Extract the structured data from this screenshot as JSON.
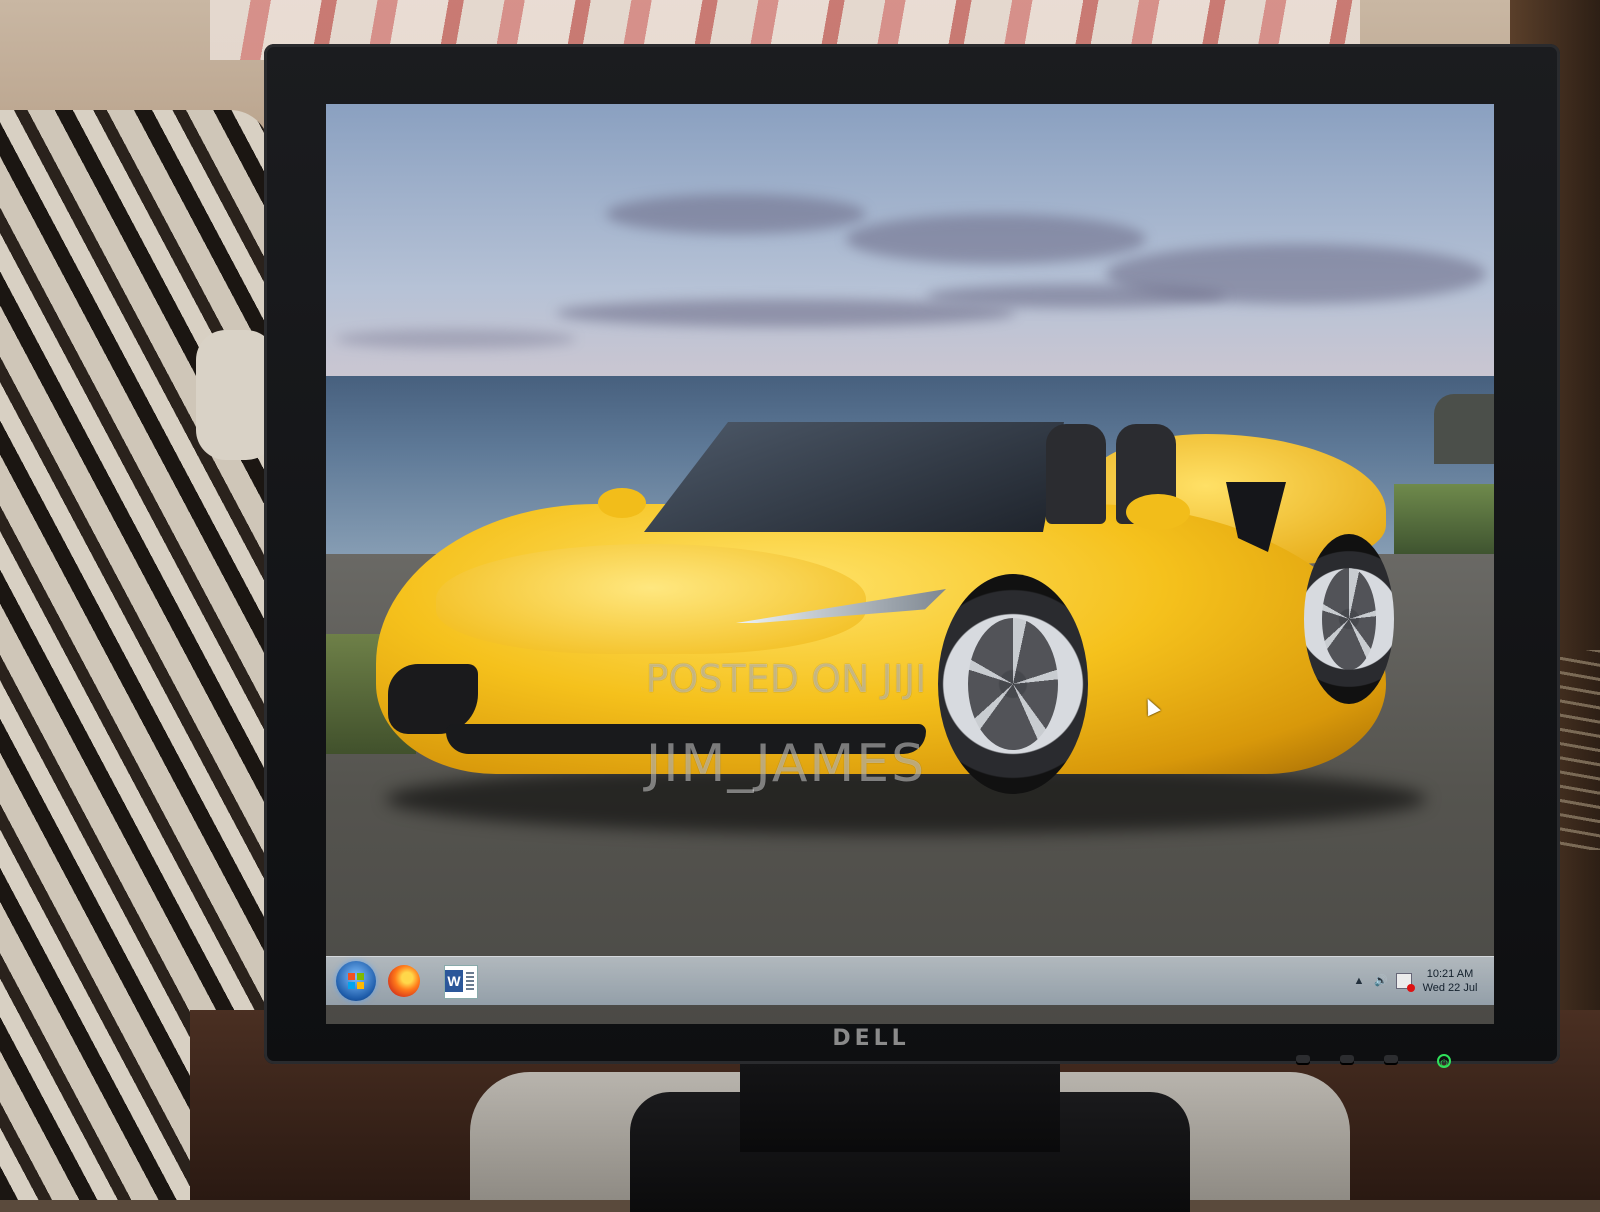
{
  "monitor": {
    "brand": "DELL"
  },
  "wallpaper": {
    "watermark_line1": "POSTED ON JIJI",
    "watermark_line2": "JIM_JAMES"
  },
  "taskbar": {
    "pinned": [
      {
        "name": "Start",
        "icon": "windows-start-orb-icon"
      },
      {
        "name": "Firefox",
        "icon": "firefox-icon"
      },
      {
        "name": "Word",
        "icon": "word-icon",
        "glyph": "W"
      }
    ],
    "tray": {
      "show_hidden_glyph": "▲",
      "volume_glyph": "🔊",
      "clock_time": "10:21 AM",
      "clock_date": "Wed 22 Jul"
    }
  },
  "colors": {
    "power_led": "#2fe05a",
    "car": "#f5c11c"
  }
}
